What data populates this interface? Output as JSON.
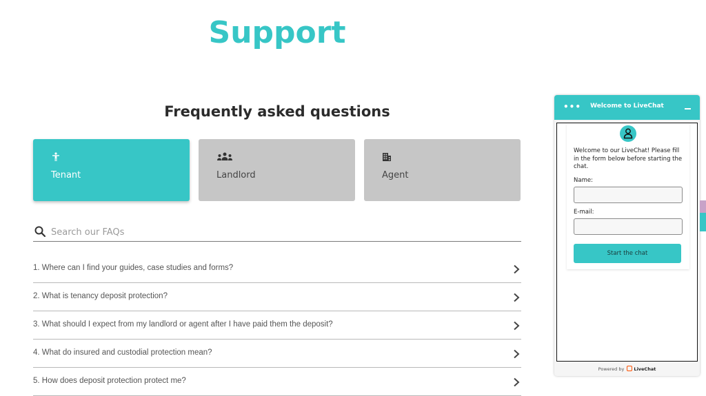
{
  "page": {
    "title": "Support",
    "faq_heading": "Frequently asked questions"
  },
  "roles": [
    {
      "label": "Tenant",
      "icon": "person-icon",
      "active": true
    },
    {
      "label": "Landlord",
      "icon": "people-group-icon",
      "active": false
    },
    {
      "label": "Agent",
      "icon": "building-icon",
      "active": false
    }
  ],
  "search": {
    "placeholder": "Search our FAQs",
    "value": ""
  },
  "faqs": [
    "1. Where can I find your guides, case studies and forms?",
    "2. What is tenancy deposit protection?",
    "3. What should I expect from my landlord or agent after I have paid them the deposit?",
    "4. What do insured and custodial protection mean?",
    "5. How does deposit protection protect me?"
  ],
  "livechat": {
    "header_title": "Welcome to LiveChat",
    "menu_icon": "more-dots-icon",
    "welcome_text": "Welcome to our LiveChat! Please fill in the form below before starting the chat.",
    "name_label": "Name:",
    "name_value": "",
    "email_label": "E-mail:",
    "email_value": "",
    "start_button": "Start the chat",
    "footer_prefix": "Powered by",
    "footer_brand": "LiveChat"
  },
  "colors": {
    "accent": "#37c6c6",
    "card_inactive": "#c6c6c6"
  }
}
